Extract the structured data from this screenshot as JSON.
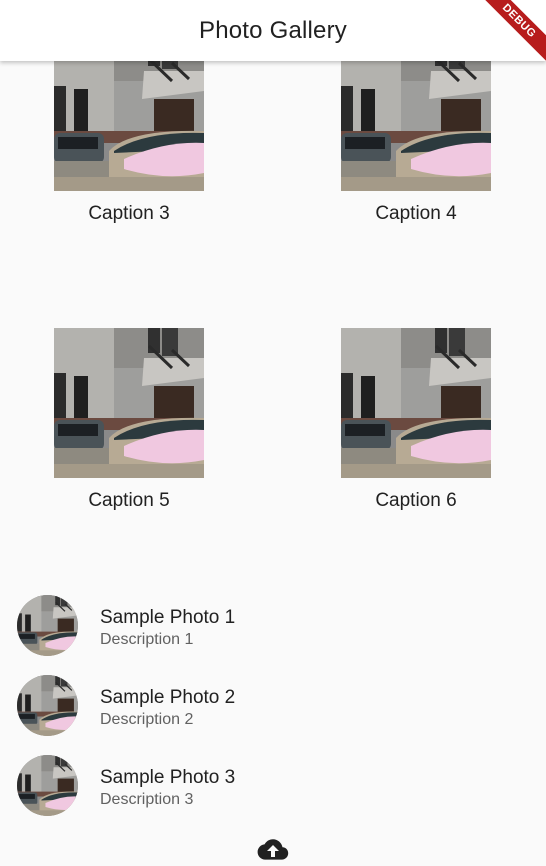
{
  "app_bar": {
    "title": "Photo Gallery",
    "debug_label": "DEBUG"
  },
  "grid": {
    "items": [
      {
        "caption": "Caption 3"
      },
      {
        "caption": "Caption 4"
      },
      {
        "caption": "Caption 5"
      },
      {
        "caption": "Caption 6"
      }
    ]
  },
  "list": {
    "items": [
      {
        "title": "Sample Photo 1",
        "subtitle": "Description 1"
      },
      {
        "title": "Sample Photo 2",
        "subtitle": "Description 2"
      },
      {
        "title": "Sample Photo 3",
        "subtitle": "Description 3"
      }
    ]
  },
  "actions": {
    "upload_icon": "cloud-upload-icon"
  }
}
